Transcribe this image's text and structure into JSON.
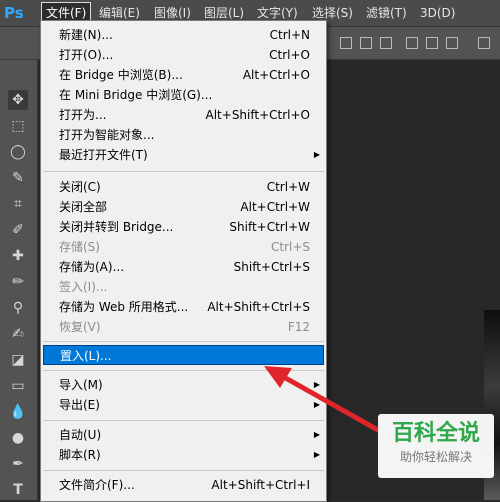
{
  "app": {
    "logo": "Ps"
  },
  "menubar": {
    "items": [
      {
        "label": "文件(F)",
        "active": true
      },
      {
        "label": "编辑(E)"
      },
      {
        "label": "图像(I)"
      },
      {
        "label": "图层(L)"
      },
      {
        "label": "文字(Y)"
      },
      {
        "label": "选择(S)"
      },
      {
        "label": "滤镜(T)"
      },
      {
        "label": "3D(D)"
      }
    ]
  },
  "file_menu": {
    "items": [
      {
        "label": "新建(N)...",
        "shortcut": "Ctrl+N"
      },
      {
        "label": "打开(O)...",
        "shortcut": "Ctrl+O"
      },
      {
        "label": "在 Bridge 中浏览(B)...",
        "shortcut": "Alt+Ctrl+O"
      },
      {
        "label": "在 Mini Bridge 中浏览(G)...",
        "shortcut": ""
      },
      {
        "label": "打开为...",
        "shortcut": "Alt+Shift+Ctrl+O"
      },
      {
        "label": "打开为智能对象...",
        "shortcut": ""
      },
      {
        "label": "最近打开文件(T)",
        "shortcut": "",
        "submenu": true
      },
      {
        "label": "关闭(C)",
        "shortcut": "Ctrl+W"
      },
      {
        "label": "关闭全部",
        "shortcut": "Alt+Ctrl+W"
      },
      {
        "label": "关闭并转到 Bridge...",
        "shortcut": "Shift+Ctrl+W"
      },
      {
        "label": "存储(S)",
        "shortcut": "Ctrl+S",
        "disabled": true
      },
      {
        "label": "存储为(A)...",
        "shortcut": "Shift+Ctrl+S"
      },
      {
        "label": "签入(I)...",
        "shortcut": "",
        "disabled": true
      },
      {
        "label": "存储为 Web 所用格式...",
        "shortcut": "Alt+Shift+Ctrl+S"
      },
      {
        "label": "恢复(V)",
        "shortcut": "F12",
        "disabled": true
      },
      {
        "label": "置入(L)...",
        "shortcut": "",
        "highlighted": true
      },
      {
        "label": "导入(M)",
        "shortcut": "",
        "submenu": true
      },
      {
        "label": "导出(E)",
        "shortcut": "",
        "submenu": true
      },
      {
        "label": "自动(U)",
        "shortcut": "",
        "submenu": true
      },
      {
        "label": "脚本(R)",
        "shortcut": "",
        "submenu": true
      },
      {
        "label": "文件简介(F)...",
        "shortcut": "Alt+Shift+Ctrl+I"
      }
    ],
    "submenu_arrow": "▶"
  },
  "watermark": {
    "title": "百科全说",
    "subtitle": "助你轻松解决"
  },
  "colors": {
    "highlight": "#0078d7",
    "arrow": "#e0262a",
    "watermark_green": "#2ea84a"
  }
}
